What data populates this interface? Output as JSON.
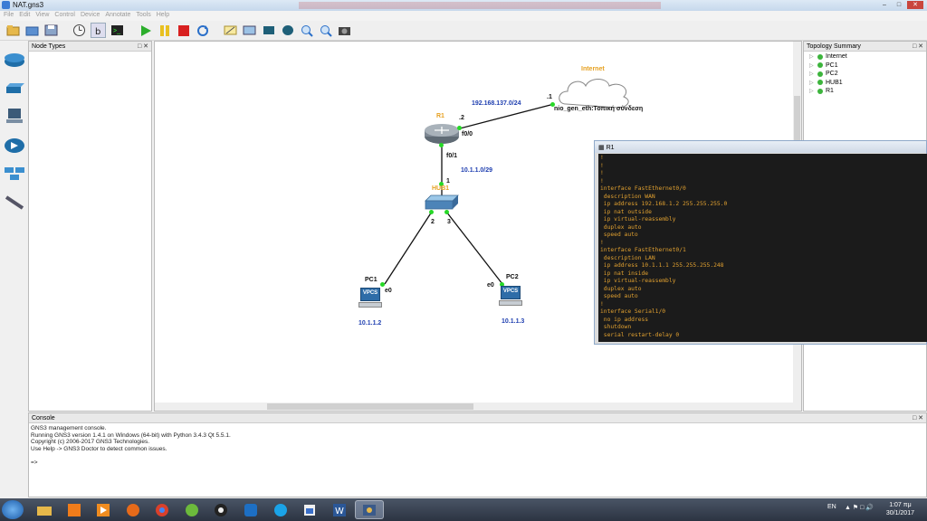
{
  "window": {
    "title": "NAT.gns3"
  },
  "menu": [
    "File",
    "Edit",
    "View",
    "Control",
    "Device",
    "Annotate",
    "Tools",
    "Help"
  ],
  "toolbar": {
    "icons": [
      "new-project-icon",
      "open-project-icon",
      "save-project-icon",
      "snapshot-icon",
      "show-interfaces-icon",
      "console-all-icon",
      "start-all-icon",
      "suspend-all-icon",
      "stop-all-icon",
      "reload-all-icon",
      "add-note-icon",
      "insert-picture-icon",
      "draw-rectangle-icon",
      "draw-ellipse-icon",
      "zoom-in-icon",
      "zoom-out-icon",
      "screenshot-icon"
    ]
  },
  "panels": {
    "node_types": {
      "title": "Node Types"
    },
    "topology_summary": {
      "title": "Topology Summary",
      "items": [
        "Internet",
        "PC1",
        "PC2",
        "HUB1",
        "R1"
      ]
    },
    "console": {
      "title": "Console",
      "lines": [
        "GNS3 management console.",
        "Running GNS3 version 1.4.1 on Windows (64-bit) with Python 3.4.3 Qt 5.5.1.",
        "Copyright (c) 2006-2017 GNS3 Technologies.",
        "Use Help -> GNS3 Doctor to detect common issues.",
        "",
        "=>"
      ]
    }
  },
  "topology": {
    "internet_label": "Internet",
    "cloud_port": "nio_gen_eth:Τοπική σύνδεση",
    "wan_net": "192.168.137.0/24",
    "wan_dot1": ".1",
    "wan_dot2": ".2",
    "r1_label": "R1",
    "r1_f00": "f0/0",
    "r1_f01": "f0/1",
    "lan_net": "10.1.1.0/29",
    "hub_label": "HUB1",
    "hub_port1": "1",
    "hub_port2": "2",
    "hub_port3": "3",
    "pc1_label": "PC1",
    "pc1_port": "e0",
    "pc1_ip": "10.1.1.2",
    "pc2_label": "PC2",
    "pc2_port": "e0",
    "pc2_ip": "10.1.1.3",
    "vpcs_text": "VPCS"
  },
  "terminal": {
    "title": "R1",
    "lines": [
      "!",
      "!",
      "!",
      "!",
      "interface FastEthernet0/0",
      " description WAN",
      " ip address 192.168.1.2 255.255.255.0",
      " ip nat outside",
      " ip virtual-reassembly",
      " duplex auto",
      " speed auto",
      "!",
      "interface FastEthernet0/1",
      " description LAN",
      " ip address 10.1.1.1 255.255.255.248",
      " ip nat inside",
      " ip virtual-reassembly",
      " duplex auto",
      " speed auto",
      "!",
      "interface Serial1/0",
      " no ip address",
      " shutdown",
      " serial restart-delay 0"
    ]
  },
  "taskbar": {
    "lang": "EN",
    "time": "1:07 πμ",
    "date": "30/1/2017"
  },
  "colors": {
    "link_dot": "#26d926",
    "label_blue": "#1f3fb0",
    "label_orange": "#e6a020",
    "terminal_text": "#e0a030",
    "terminal_bg": "#1b1b1b"
  }
}
